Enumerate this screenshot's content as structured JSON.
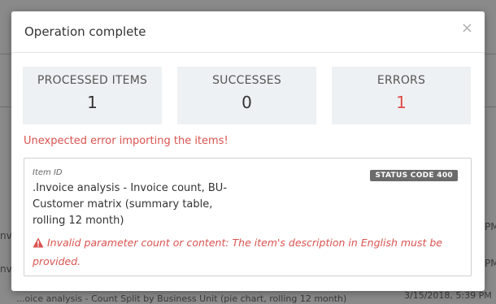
{
  "background": {
    "row_text_1": "nv",
    "row_text_2": "nv",
    "right_text_1": "PM",
    "right_text_2": "PM",
    "timestamp": "3/15/2018, 5:39 PM",
    "bottom_text": "...oice analysis - Count Split by Business Unit (pie chart, rolling 12 month)"
  },
  "modal": {
    "title": "Operation complete",
    "close_symbol": "×",
    "stats": [
      {
        "label": "PROCESSED ITEMS",
        "value": "1"
      },
      {
        "label": "SUCCESSES",
        "value": "0"
      },
      {
        "label": "ERRORS",
        "value": "1"
      }
    ],
    "error_message": "Unexpected error importing the items!",
    "detail": {
      "item_id_label": "Item ID",
      "item_name": ".Invoice analysis - Invoice count, BU-Customer matrix (summary table, rolling 12 month)",
      "status_badge": "STATUS CODE 400",
      "warning_icon": "warning-triangle-icon",
      "warning_text": "Invalid parameter count or content: The item's description in English must be provided."
    }
  },
  "colors": {
    "error": "#d9534f",
    "overlay": "#8a8a8a",
    "stat_bg": "#eef1f3"
  }
}
